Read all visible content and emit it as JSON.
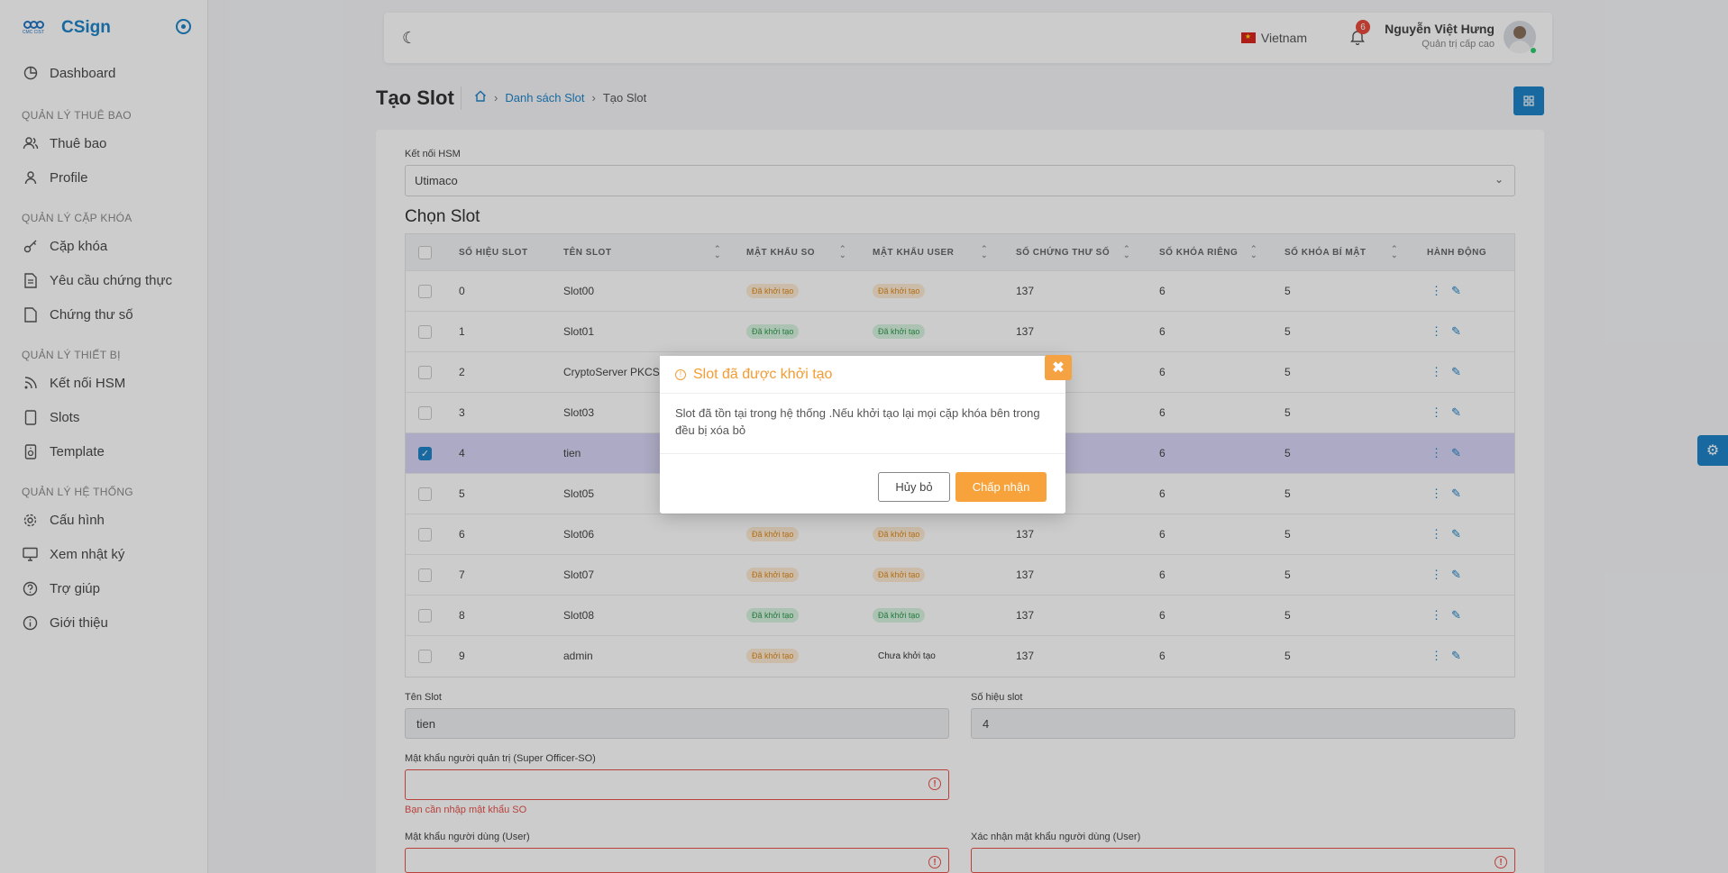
{
  "brand": {
    "name": "CSign",
    "logo_text": "CMC CIST"
  },
  "sidebar": {
    "dashboard": "Dashboard",
    "section_subscribers": "QUẢN LÝ THUÊ BAO",
    "subscribers": "Thuê bao",
    "profile": "Profile",
    "section_keys": "QUẢN LÝ CẶP KHÓA",
    "keypair": "Cặp khóa",
    "cert_request": "Yêu cầu chứng thực",
    "digital_cert": "Chứng thư số",
    "section_devices": "QUẢN LÝ THIẾT BỊ",
    "hsm": "Kết nối HSM",
    "slots": "Slots",
    "template": "Template",
    "section_system": "QUẢN LÝ HỆ THỐNG",
    "config": "Cấu hình",
    "logs": "Xem nhật ký",
    "help": "Trợ giúp",
    "about": "Giới thiệu"
  },
  "topbar": {
    "language": "Vietnam",
    "notifications": "6",
    "user_name": "Nguyễn Việt Hưng",
    "user_role": "Quản trị cấp cao"
  },
  "page": {
    "title": "Tạo Slot",
    "breadcrumb_list": "Danh sách Slot",
    "breadcrumb_current": "Tạo Slot"
  },
  "form": {
    "hsm_label": "Kết nối HSM",
    "hsm_value": "Utimaco",
    "choose_slot": "Chọn Slot",
    "slot_name_label": "Tên Slot",
    "slot_name_value": "tien",
    "slot_number_label": "Số hiệu slot",
    "slot_number_value": "4",
    "so_password_label": "Mật khẩu người quản trị (Super Officer-SO)",
    "so_password_error": "Bạn cần nhập mật khẩu SO",
    "user_password_label": "Mật khẩu người dùng (User)",
    "user_password_confirm_label": "Xác nhận mật khẩu người dùng (User)"
  },
  "table": {
    "headers": [
      "SỐ HIỆU SLOT",
      "TÊN SLOT",
      "MẬT KHẨU SO",
      "MẬT KHẨU USER",
      "SỐ CHỨNG THƯ SỐ",
      "SỐ KHÓA RIÊNG",
      "SỐ KHÓA BÍ MẬT",
      "HÀNH ĐỘNG"
    ],
    "rows": [
      {
        "id": "0",
        "name": "Slot00",
        "so": "Đã khởi tạo",
        "so_color": "orange",
        "user": "Đã khởi tạo",
        "user_color": "orange",
        "certs": "137",
        "priv": "6",
        "secret": "5",
        "checked": false
      },
      {
        "id": "1",
        "name": "Slot01",
        "so": "Đã khởi tạo",
        "so_color": "green",
        "user": "Đã khởi tạo",
        "user_color": "green",
        "certs": "137",
        "priv": "6",
        "secret": "5",
        "checked": false
      },
      {
        "id": "2",
        "name": "CryptoServer PKCS",
        "so": "",
        "so_color": "none",
        "user": "",
        "user_color": "none",
        "certs": "",
        "priv": "6",
        "secret": "5",
        "checked": false
      },
      {
        "id": "3",
        "name": "Slot03",
        "so": "",
        "so_color": "none",
        "user": "",
        "user_color": "none",
        "certs": "",
        "priv": "6",
        "secret": "5",
        "checked": false
      },
      {
        "id": "4",
        "name": "tien",
        "so": "",
        "so_color": "none",
        "user": "",
        "user_color": "none",
        "certs": "",
        "priv": "6",
        "secret": "5",
        "checked": true
      },
      {
        "id": "5",
        "name": "Slot05",
        "so": "",
        "so_color": "none",
        "user": "",
        "user_color": "none",
        "certs": "",
        "priv": "6",
        "secret": "5",
        "checked": false
      },
      {
        "id": "6",
        "name": "Slot06",
        "so": "Đã khởi tạo",
        "so_color": "orange",
        "user": "Đã khởi tạo",
        "user_color": "orange",
        "certs": "137",
        "priv": "6",
        "secret": "5",
        "checked": false
      },
      {
        "id": "7",
        "name": "Slot07",
        "so": "Đã khởi tạo",
        "so_color": "orange",
        "user": "Đã khởi tạo",
        "user_color": "orange",
        "certs": "137",
        "priv": "6",
        "secret": "5",
        "checked": false
      },
      {
        "id": "8",
        "name": "Slot08",
        "so": "Đã khởi tạo",
        "so_color": "green",
        "user": "Đã khởi tạo",
        "user_color": "green",
        "certs": "137",
        "priv": "6",
        "secret": "5",
        "checked": false
      },
      {
        "id": "9",
        "name": "admin",
        "so": "Đã khởi tạo",
        "so_color": "orange",
        "user": "Chưa khởi tạo",
        "user_color": "plain",
        "certs": "137",
        "priv": "6",
        "secret": "5",
        "checked": false
      }
    ]
  },
  "modal": {
    "title": "Slot đã được khởi tạo",
    "message": "Slot đã tồn tại trong hệ thống .Nếu khởi tạo lại mọi cặp khóa bên trong đều bị xóa bỏ",
    "cancel": "Hủy bỏ",
    "confirm": "Chấp nhận"
  },
  "colors": {
    "accent": "#1f84c8",
    "warning": "#f39c33",
    "error": "#e8504a"
  }
}
